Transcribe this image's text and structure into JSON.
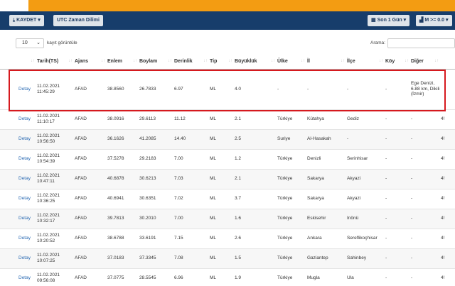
{
  "toolbar": {
    "save_label": "KAYDET",
    "utc_label": "UTC Zaman Dilimi",
    "period_label": "Son 1 Gün",
    "magnitude_label": "M >= 0.0"
  },
  "controls": {
    "page_length": "10",
    "page_length_label": "kayıt görüntüle",
    "search_label": "Arama:",
    "search_value": ""
  },
  "table": {
    "headers": [
      "Tarih(TS)",
      "Ajans",
      "Enlem",
      "Boylam",
      "Derinlik",
      "Tip",
      "Büyüklük",
      "Ülke",
      "İl",
      "İlçe",
      "Köy",
      "Diğer"
    ],
    "detail_label": "Detay",
    "rows": [
      {
        "date": "11.02.2021",
        "time": "11:45:29",
        "agency": "AFAD",
        "lat": "38.8560",
        "lon": "26.7833",
        "depth": "6.97",
        "type": "ML",
        "mag": "4.0",
        "country": "-",
        "province": "-",
        "district": "-",
        "village": "-",
        "other": "Ege Denizi, 6.88 km, Dikili (İzmir)",
        "extra": ""
      },
      {
        "date": "11.02.2021",
        "time": "11:10:17",
        "agency": "AFAD",
        "lat": "38.0916",
        "lon": "29.6113",
        "depth": "11.12",
        "type": "ML",
        "mag": "2.1",
        "country": "Türkiye",
        "province": "Kütahya",
        "district": "Gediz",
        "village": "-",
        "other": "-",
        "extra": "4!"
      },
      {
        "date": "11.02.2021",
        "time": "10:56:50",
        "agency": "AFAD",
        "lat": "36.1626",
        "lon": "41.2085",
        "depth": "14.40",
        "type": "ML",
        "mag": "2.5",
        "country": "Suriye",
        "province": "Al-Hasakah",
        "district": "-",
        "village": "-",
        "other": "-",
        "extra": "4!"
      },
      {
        "date": "11.02.2021",
        "time": "10:54:39",
        "agency": "AFAD",
        "lat": "37.5278",
        "lon": "29.2183",
        "depth": "7.00",
        "type": "ML",
        "mag": "1.2",
        "country": "Türkiye",
        "province": "Denizli",
        "district": "Serinhisar",
        "village": "-",
        "other": "-",
        "extra": "4!"
      },
      {
        "date": "11.02.2021",
        "time": "10:47:11",
        "agency": "AFAD",
        "lat": "40.6878",
        "lon": "30.6213",
        "depth": "7.03",
        "type": "ML",
        "mag": "2.1",
        "country": "Türkiye",
        "province": "Sakarya",
        "district": "Akyazi",
        "village": "-",
        "other": "-",
        "extra": "4!"
      },
      {
        "date": "11.02.2021",
        "time": "10:36:25",
        "agency": "AFAD",
        "lat": "40.6941",
        "lon": "30.6351",
        "depth": "7.02",
        "type": "ML",
        "mag": "3.7",
        "country": "Türkiye",
        "province": "Sakarya",
        "district": "Akyazi",
        "village": "-",
        "other": "-",
        "extra": "4!"
      },
      {
        "date": "11.02.2021",
        "time": "10:32:17",
        "agency": "AFAD",
        "lat": "39.7813",
        "lon": "30.2010",
        "depth": "7.00",
        "type": "ML",
        "mag": "1.6",
        "country": "Türkiye",
        "province": "Eskisehir",
        "district": "Inönü",
        "village": "-",
        "other": "-",
        "extra": "4!"
      },
      {
        "date": "11.02.2021",
        "time": "10:20:52",
        "agency": "AFAD",
        "lat": "38.6788",
        "lon": "33.6191",
        "depth": "7.15",
        "type": "ML",
        "mag": "2.6",
        "country": "Türkiye",
        "province": "Ankara",
        "district": "Sereflikoçhisar",
        "village": "-",
        "other": "-",
        "extra": "4!"
      },
      {
        "date": "11.02.2021",
        "time": "10:07:25",
        "agency": "AFAD",
        "lat": "37.0183",
        "lon": "37.3345",
        "depth": "7.08",
        "type": "ML",
        "mag": "1.5",
        "country": "Türkiye",
        "province": "Gaziantep",
        "district": "Sahinbey",
        "village": "-",
        "other": "-",
        "extra": "4!"
      },
      {
        "date": "11.02.2021",
        "time": "09:56:08",
        "agency": "AFAD",
        "lat": "37.0775",
        "lon": "28.5545",
        "depth": "6.96",
        "type": "ML",
        "mag": "1.9",
        "country": "Türkiye",
        "province": "Mugla",
        "district": "Ula",
        "village": "-",
        "other": "-",
        "extra": "4!"
      }
    ]
  },
  "colors": {
    "toolbar_bg": "#173d6b",
    "orange_band": "#f39c12",
    "highlight": "#d6191e",
    "link": "#2a6ab3"
  }
}
